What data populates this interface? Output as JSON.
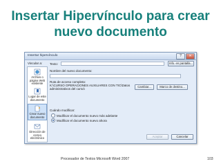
{
  "slide": {
    "title_line1": "Insertar Hipervínculo para crear",
    "title_line2": "nuevo documento",
    "footer": "Procesador de Textos Microsoft Word 2007",
    "page": "103"
  },
  "dialog": {
    "title": "Insertar hipervínculo",
    "help_btn": "?",
    "close_btn": "✕",
    "link_to_label": "Vincular a:",
    "text_label": "Texto:",
    "text_value": "",
    "screentip_btn": "Info. en pantalla...",
    "sidebar": [
      {
        "icon": "web-page-icon",
        "label_lines": [
          "Archivo o",
          "página Web",
          "existente"
        ]
      },
      {
        "icon": "bookmark-place-icon",
        "label_lines": [
          "Lugar de este",
          "documento"
        ]
      },
      {
        "icon": "new-document-icon",
        "label_lines": [
          "Crear nuevo",
          "documento"
        ],
        "selected": true
      },
      {
        "icon": "email-icon",
        "label_lines": [
          "Dirección de",
          "correo",
          "electrónico"
        ]
      }
    ],
    "new_doc_name_label": "Nombre del nuevo documento:",
    "new_doc_name_value": "",
    "full_path_label": "Ruta de acceso completa:",
    "full_path_value": "K:\\CURSO OPERACIONES AUXILIARES CON TIC\\Datos administrativos del curso\\",
    "change_btn": "Cambiar...",
    "target_frame_btn": "Marco de destino...",
    "when_to_edit_label": "Cuándo modificar:",
    "edit_later": "Modificar el documento nuevo más adelante",
    "edit_now": "Modificar el documento nuevo ahora",
    "ok_btn": "Aceptar",
    "cancel_btn": "Cancelar"
  },
  "colors": {
    "title": "#17807b",
    "dialog_bg": "#e3ecf8"
  }
}
